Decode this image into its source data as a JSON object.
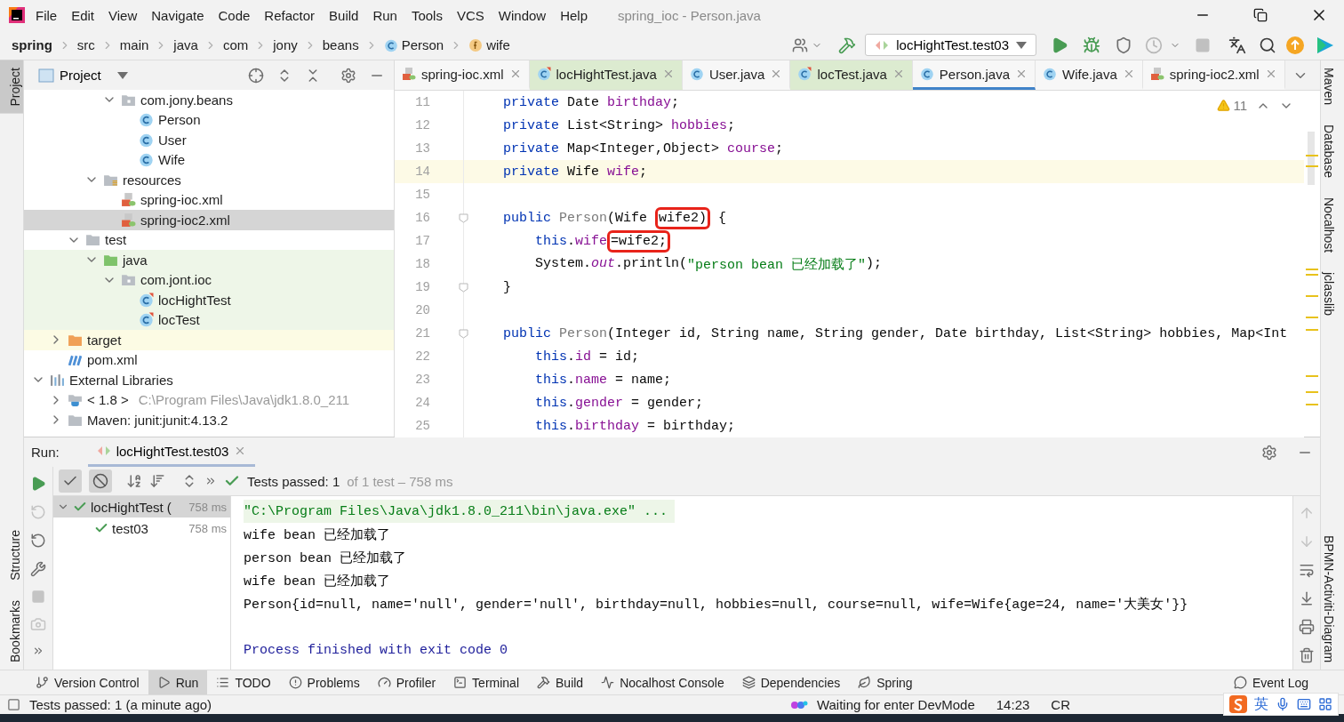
{
  "window": {
    "title": "spring_ioc - Person.java"
  },
  "menu": [
    "File",
    "Edit",
    "View",
    "Navigate",
    "Code",
    "Refactor",
    "Build",
    "Run",
    "Tools",
    "VCS",
    "Window",
    "Help"
  ],
  "breadcrumb": [
    {
      "label": "spring",
      "kind": "project"
    },
    {
      "label": "src",
      "kind": "dir"
    },
    {
      "label": "main",
      "kind": "dir"
    },
    {
      "label": "java",
      "kind": "dir"
    },
    {
      "label": "com",
      "kind": "dir"
    },
    {
      "label": "jony",
      "kind": "dir"
    },
    {
      "label": "beans",
      "kind": "dir"
    },
    {
      "label": "Person",
      "kind": "class"
    },
    {
      "label": "wife",
      "kind": "field"
    }
  ],
  "run_config": {
    "label": "locHightTest.test03"
  },
  "left_stripe": {
    "top": [
      {
        "label": "Project",
        "selected": true
      }
    ],
    "bottom": [
      {
        "label": "Structure",
        "selected": false
      },
      {
        "label": "Bookmarks",
        "selected": false
      }
    ]
  },
  "right_stripe": {
    "top": [
      "Maven",
      "Database",
      "Nocalhost",
      "jclasslib"
    ],
    "bottom": [
      "BPMN-Activiti-Diagram"
    ]
  },
  "project_panel": {
    "title": "Project",
    "tree": [
      {
        "children": [
          {
            "children": [
              {
                "children": [
                  {
                    "children": [
                      {
                        "label": "com.jony.beans",
                        "kind": "package",
                        "selected": false,
                        "expanded": true,
                        "children": [
                          {
                            "label": "Person",
                            "kind": "class",
                            "selected": false
                          },
                          {
                            "label": "User",
                            "kind": "class",
                            "selected": false
                          },
                          {
                            "label": "Wife",
                            "kind": "class",
                            "selected": false
                          }
                        ]
                      }
                    ]
                  },
                  {
                    "label": "resources",
                    "kind": "resources",
                    "selected": false,
                    "expanded": true,
                    "children": [
                      {
                        "label": "spring-ioc.xml",
                        "kind": "xml",
                        "selected": false
                      },
                      {
                        "label": "spring-ioc2.xml",
                        "kind": "xml",
                        "selected": true
                      }
                    ]
                  }
                ]
              },
              {
                "label": "test",
                "kind": "folder",
                "selected": false,
                "expanded": true,
                "children": [
                  {
                    "label": "java",
                    "kind": "source-folder",
                    "in_tests": true,
                    "selected": false,
                    "expanded": true,
                    "children": [
                      {
                        "label": "com.jont.ioc",
                        "kind": "package",
                        "in_tests": true,
                        "selected": false,
                        "expanded": true,
                        "children": [
                          {
                            "label": "locHightTest",
                            "kind": "test-class",
                            "in_tests": true,
                            "selected": false
                          },
                          {
                            "label": "locTest",
                            "kind": "test-class",
                            "in_tests": true,
                            "selected": false
                          }
                        ]
                      }
                    ]
                  }
                ]
              }
            ]
          },
          {
            "label": "target",
            "kind": "excluded-folder",
            "excluded": true,
            "selected": false,
            "expanded": false
          },
          {
            "label": "pom.xml",
            "kind": "maven",
            "selected": false
          }
        ]
      },
      {
        "label": "External Libraries",
        "kind": "libraries",
        "selected": false,
        "expanded": true,
        "children": [
          {
            "label": "< 1.8 >",
            "note": "C:\\Program Files\\Java\\jdk1.8.0_211",
            "kind": "jdk",
            "selected": false,
            "expanded": false
          },
          {
            "label": "Maven: junit:junit:4.13.2",
            "kind": "jar",
            "selected": false,
            "expanded": false
          }
        ]
      }
    ]
  },
  "editor": {
    "tabs": [
      {
        "label": "spring-ioc.xml",
        "kind": "xml",
        "selected": false
      },
      {
        "label": "locHightTest.java",
        "kind": "test-class",
        "in_tests": true,
        "selected": false
      },
      {
        "label": "User.java",
        "kind": "class",
        "selected": false
      },
      {
        "label": "locTest.java",
        "kind": "test-class",
        "in_tests": true,
        "selected": false
      },
      {
        "label": "Person.java",
        "kind": "class",
        "selected": true
      },
      {
        "label": "Wife.java",
        "kind": "class",
        "selected": false
      },
      {
        "label": "spring-ioc2.xml",
        "kind": "xml",
        "selected": false
      }
    ],
    "warnings": "11",
    "lines": [
      {
        "number": "11",
        "kind": "member",
        "current": false,
        "fold": false,
        "tokens": [
          {
            "kind": "kw",
            "text": "private "
          },
          {
            "kind": "plain",
            "text": "Date "
          },
          {
            "kind": "field",
            "text": "birthday"
          },
          {
            "kind": "plain",
            "text": ";"
          }
        ]
      },
      {
        "number": "12",
        "kind": "member",
        "current": false,
        "fold": false,
        "tokens": [
          {
            "kind": "kw",
            "text": "private "
          },
          {
            "kind": "plain",
            "text": "List<String> "
          },
          {
            "kind": "field",
            "text": "hobbies"
          },
          {
            "kind": "plain",
            "text": ";"
          }
        ]
      },
      {
        "number": "13",
        "kind": "member",
        "current": false,
        "fold": false,
        "tokens": [
          {
            "kind": "kw",
            "text": "private "
          },
          {
            "kind": "plain",
            "text": "Map<Integer,Object> "
          },
          {
            "kind": "field",
            "text": "course"
          },
          {
            "kind": "plain",
            "text": ";"
          }
        ]
      },
      {
        "number": "14",
        "kind": "member",
        "current": true,
        "fold": false,
        "tokens": [
          {
            "kind": "kw",
            "text": "private "
          },
          {
            "kind": "plain",
            "text": "Wife "
          },
          {
            "kind": "field",
            "text": "wife"
          },
          {
            "kind": "plain",
            "text": ";"
          }
        ]
      },
      {
        "number": "15",
        "kind": "member",
        "current": false,
        "fold": false
      },
      {
        "number": "16",
        "kind": "member",
        "current": false,
        "fold": true,
        "tokens": [
          {
            "kind": "kw",
            "text": "public "
          },
          {
            "kind": "muted",
            "text": "Person"
          },
          {
            "kind": "plain",
            "text": "(Wife "
          },
          {
            "kind": "plain",
            "text": "wife2)",
            "boxed": true
          },
          {
            "kind": "plain",
            "text": " {"
          }
        ]
      },
      {
        "number": "17",
        "kind": "statement",
        "current": false,
        "fold": false,
        "tokens": [
          {
            "kind": "kw",
            "text": "this"
          },
          {
            "kind": "plain",
            "text": "."
          },
          {
            "kind": "field",
            "text": "wife"
          },
          {
            "kind": "plain",
            "text": "=wife2;",
            "boxed": true
          }
        ]
      },
      {
        "number": "18",
        "kind": "statement",
        "current": false,
        "fold": false,
        "tokens": [
          {
            "kind": "plain",
            "text": "System."
          },
          {
            "kind": "static",
            "text": "out"
          },
          {
            "kind": "plain",
            "text": ".println("
          },
          {
            "kind": "string",
            "text": "\"person bean 已经加载了\""
          },
          {
            "kind": "plain",
            "text": ");"
          }
        ]
      },
      {
        "number": "19",
        "kind": "member",
        "current": false,
        "fold": true,
        "tokens": [
          {
            "kind": "plain",
            "text": "}"
          }
        ]
      },
      {
        "number": "20",
        "kind": "member",
        "current": false,
        "fold": false
      },
      {
        "number": "21",
        "kind": "member",
        "current": false,
        "fold": true,
        "tokens": [
          {
            "kind": "kw",
            "text": "public "
          },
          {
            "kind": "muted",
            "text": "Person"
          },
          {
            "kind": "plain",
            "text": "(Integer id, String name, String gender, Date birthday, List<String> hobbies, Map<Int"
          }
        ]
      },
      {
        "number": "22",
        "kind": "statement",
        "current": false,
        "fold": false,
        "tokens": [
          {
            "kind": "kw",
            "text": "this"
          },
          {
            "kind": "plain",
            "text": "."
          },
          {
            "kind": "field",
            "text": "id"
          },
          {
            "kind": "plain",
            "text": " = id;"
          }
        ]
      },
      {
        "number": "23",
        "kind": "statement",
        "current": false,
        "fold": false,
        "tokens": [
          {
            "kind": "kw",
            "text": "this"
          },
          {
            "kind": "plain",
            "text": "."
          },
          {
            "kind": "field",
            "text": "name"
          },
          {
            "kind": "plain",
            "text": " = name;"
          }
        ]
      },
      {
        "number": "24",
        "kind": "statement",
        "current": false,
        "fold": false,
        "tokens": [
          {
            "kind": "kw",
            "text": "this"
          },
          {
            "kind": "plain",
            "text": "."
          },
          {
            "kind": "field",
            "text": "gender"
          },
          {
            "kind": "plain",
            "text": " = gender;"
          }
        ]
      },
      {
        "number": "25",
        "kind": "statement",
        "current": false,
        "fold": false,
        "tokens": [
          {
            "kind": "kw",
            "text": "this"
          },
          {
            "kind": "plain",
            "text": "."
          },
          {
            "kind": "field",
            "text": "birthday"
          },
          {
            "kind": "plain",
            "text": " = birthday;"
          }
        ]
      }
    ]
  },
  "run": {
    "title": "Run:",
    "tab": "locHightTest.test03",
    "summary": "Tests passed: 1",
    "detail": "of 1 test – 758 ms",
    "filters": [
      {
        "kind": "passed",
        "selected": true
      },
      {
        "kind": "ignored",
        "selected": true
      }
    ],
    "tests": [
      {
        "label": "locHightTest (",
        "time": "758 ms",
        "passed": true,
        "selected": true,
        "children": [
          {
            "label": "test03",
            "time": "758 ms",
            "passed": true,
            "selected": false
          }
        ]
      }
    ],
    "console": [
      {
        "kind": "command",
        "text": "\"C:\\Program Files\\Java\\jdk1.8.0_211\\bin\\java.exe\" ..."
      },
      {
        "kind": "output",
        "text": "wife bean 已经加载了"
      },
      {
        "kind": "output",
        "text": "person bean 已经加载了"
      },
      {
        "kind": "output",
        "text": "wife bean 已经加载了"
      },
      {
        "kind": "output",
        "text": "Person{id=null, name='null', gender='null', birthday=null, hobbies=null, course=null, wife=Wife{age=24, name='大美女'}}"
      },
      {
        "kind": "exit",
        "text": "Process finished with exit code 0"
      }
    ]
  },
  "tool_windows": [
    {
      "label": "Version Control",
      "selected": false
    },
    {
      "label": "Run",
      "selected": true
    },
    {
      "label": "TODO",
      "selected": false
    },
    {
      "label": "Problems",
      "selected": false
    },
    {
      "label": "Profiler",
      "selected": false
    },
    {
      "label": "Terminal",
      "selected": false
    },
    {
      "label": "Build",
      "selected": false
    },
    {
      "label": "Nocalhost Console",
      "selected": false
    },
    {
      "label": "Dependencies",
      "selected": false
    },
    {
      "label": "Spring",
      "selected": false
    },
    {
      "label": "Event Log",
      "selected": false
    }
  ],
  "status": {
    "message": "Tests passed: 1 (a minute ago)",
    "devmode": "Waiting for enter DevMode",
    "position": "14:23",
    "line_separator": "CR"
  },
  "ime": {
    "label": "英"
  }
}
